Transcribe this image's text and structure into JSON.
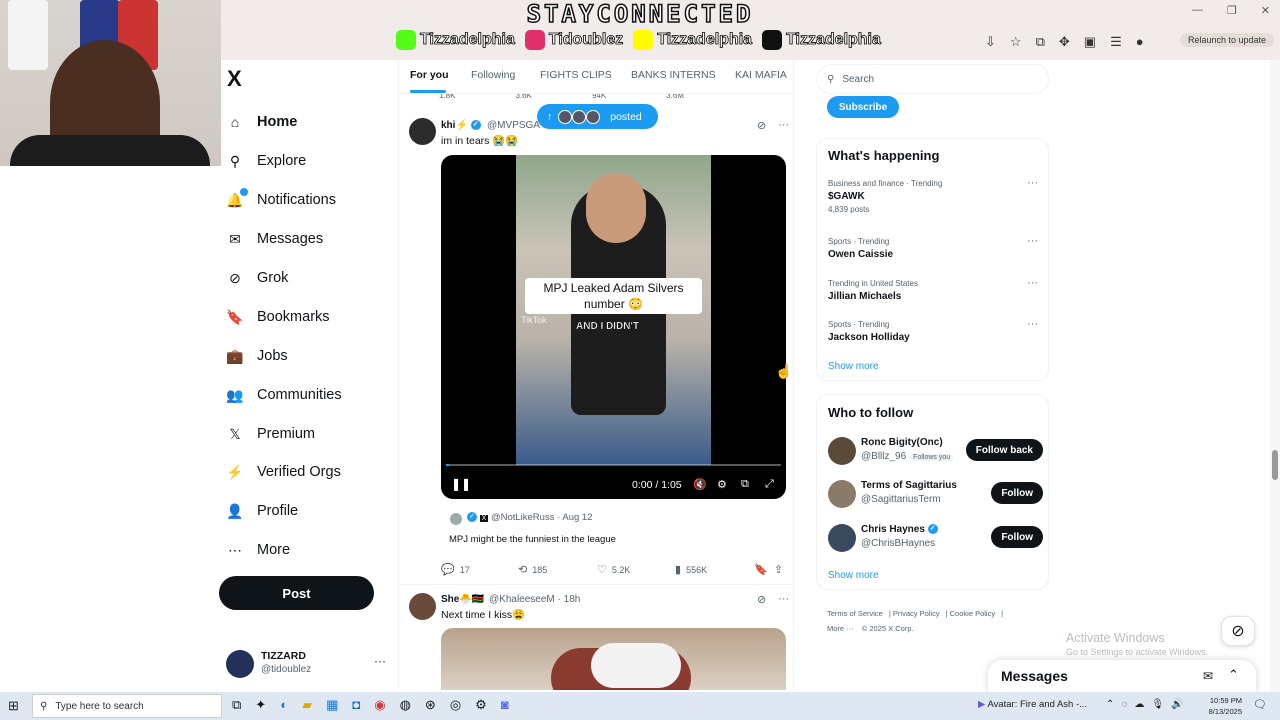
{
  "overlay": {
    "banner_title": "STAYCONNECTED",
    "socials": [
      {
        "icon": "kick-icon",
        "color": "#53fc18",
        "handle": "Tizzadelphia"
      },
      {
        "icon": "instagram-icon",
        "color": "#e1306c",
        "handle": "Tidoublez"
      },
      {
        "icon": "snapchat-icon",
        "color": "#fffc00",
        "handle": "Tizzadelphia"
      },
      {
        "icon": "tiktok-icon",
        "color": "#111111",
        "handle": "Tizzadelphia"
      }
    ]
  },
  "browser": {
    "relaunch_label": "Relaunch to update"
  },
  "nav": {
    "logo": "X",
    "items": [
      {
        "icon": "home-icon",
        "glyph": "⌂",
        "label": "Home",
        "active": true
      },
      {
        "icon": "search-icon",
        "glyph": "⚲",
        "label": "Explore"
      },
      {
        "icon": "bell-icon",
        "glyph": "🔔",
        "label": "Notifications",
        "badge": true
      },
      {
        "icon": "envelope-icon",
        "glyph": "✉",
        "label": "Messages"
      },
      {
        "icon": "grok-icon",
        "glyph": "⊘",
        "label": "Grok"
      },
      {
        "icon": "bookmark-icon",
        "glyph": "🔖",
        "label": "Bookmarks"
      },
      {
        "icon": "briefcase-icon",
        "glyph": "💼",
        "label": "Jobs"
      },
      {
        "icon": "communities-icon",
        "glyph": "👥",
        "label": "Communities"
      },
      {
        "icon": "x-premium-icon",
        "glyph": "𝕏",
        "label": "Premium"
      },
      {
        "icon": "lightning-icon",
        "glyph": "⚡",
        "label": "Verified Orgs"
      },
      {
        "icon": "person-icon",
        "glyph": "👤",
        "label": "Profile"
      },
      {
        "icon": "more-circle-icon",
        "glyph": "⋯",
        "label": "More"
      }
    ],
    "post_label": "Post",
    "account": {
      "name": "TIZZARD",
      "handle": "@tidoublez"
    }
  },
  "feed": {
    "tabs": [
      "For you",
      "Following",
      "FIGHTS CLIPS",
      "BANKS INTERNS",
      "KAI MAFIA"
    ],
    "prev_stats": [
      "1.8K",
      "3.6K",
      "94K",
      "3.6M"
    ],
    "posted_label": "posted",
    "tweet1": {
      "name": "khi⚡",
      "handle": "@MVPSGA",
      "text": "im in tears 😭😭",
      "video": {
        "caption": "MPJ Leaked Adam Silvers number 😳",
        "subtitle": "AND I DIDN'T",
        "watermark": "TikTok",
        "time": "0:00 / 1:05",
        "progress": 0.01
      },
      "quote": {
        "handle": "@NotLikeRuss",
        "date": "Aug 12",
        "text": "MPJ might be the funniest in the league"
      },
      "stats": {
        "replies": "17",
        "reposts": "185",
        "likes": "5.2K",
        "views": "556K"
      }
    },
    "tweet2": {
      "name": "She🐣🇰🇪",
      "handle": "@KhaleeseeM",
      "time": "18h",
      "text": "Next time I kiss😩"
    }
  },
  "sidebar": {
    "search_placeholder": "Search",
    "subscribe_label": "Subscribe",
    "happening_title": "What's happening",
    "trends": [
      {
        "category": "Business and finance · Trending",
        "title": "$GAWK",
        "count": "4,839 posts"
      },
      {
        "category": "Sports · Trending",
        "title": "Owen Caissie",
        "count": ""
      },
      {
        "category": "Trending in United States",
        "title": "Jillian Michaels",
        "count": ""
      },
      {
        "category": "Sports · Trending",
        "title": "Jackson Holliday",
        "count": ""
      }
    ],
    "show_more": "Show more",
    "follow_title": "Who to follow",
    "follows": [
      {
        "name": "Ronc Bigity(Onc)",
        "handle": "@Blllz_96",
        "follows_you": "Follows you",
        "button": "Follow back",
        "avatar_color": "#5a4a3a"
      },
      {
        "name": "Terms of Sagittarius",
        "handle": "@SagittariusTerm",
        "follows_you": "",
        "button": "Follow",
        "avatar_color": "#8a7a6a"
      },
      {
        "name": "Chris Haynes",
        "handle": "@ChrisBHaynes",
        "follows_you": "",
        "button": "Follow",
        "avatar_color": "#3a4a5e"
      }
    ],
    "show_more_2": "Show more",
    "footer": [
      "Terms of Service",
      "Privacy Policy",
      "Cookie Policy",
      "More ···",
      "© 2025 X Corp."
    ]
  },
  "windows": {
    "activate_title": "Activate Windows",
    "activate_sub": "Go to Settings to activate Windows.",
    "search_placeholder": "Type here to search",
    "media_title": "Avatar: Fire and Ash -...",
    "time": "10:59 PM",
    "date": "8/13/2025"
  },
  "messages_drawer": {
    "title": "Messages"
  }
}
